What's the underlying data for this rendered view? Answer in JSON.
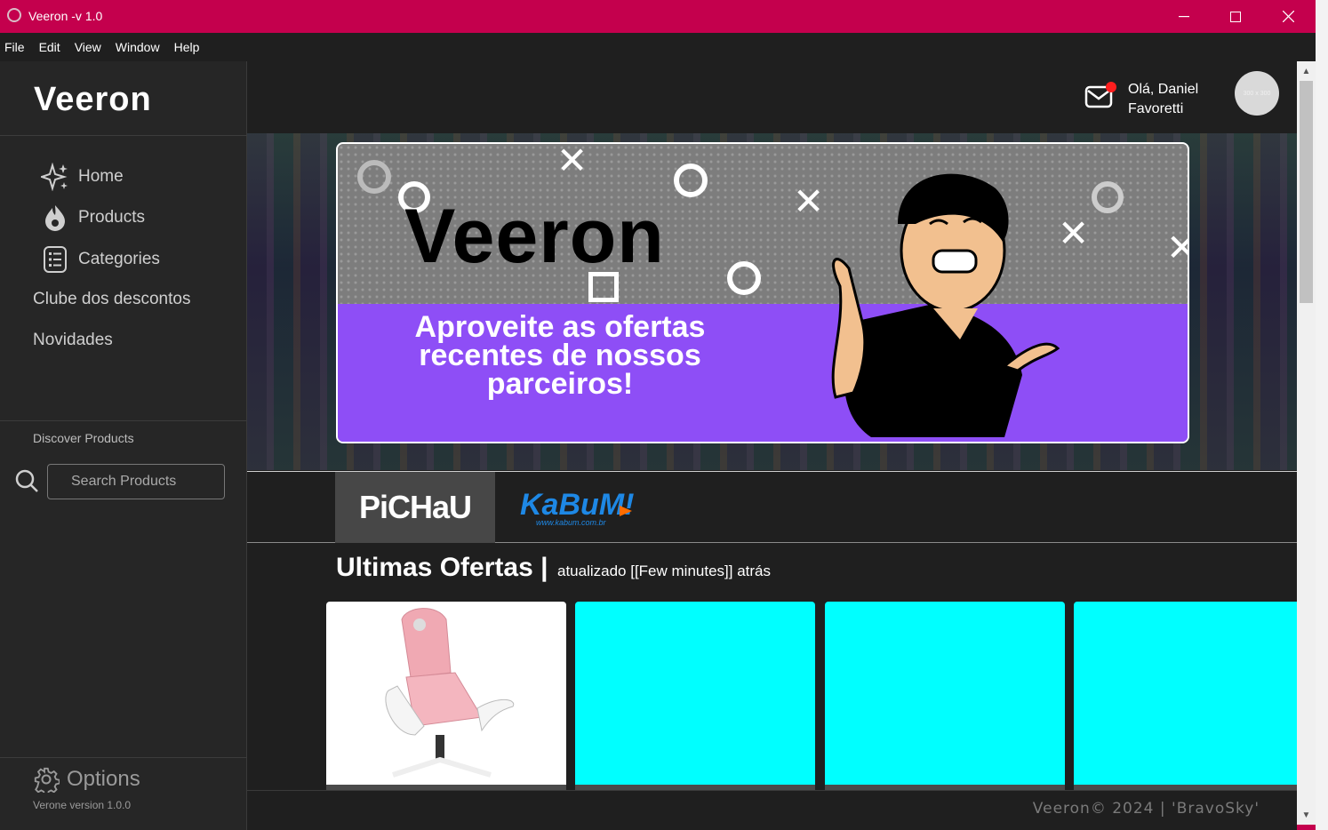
{
  "window": {
    "title": "Veeron -v 1.0",
    "accent": "#c4004d"
  },
  "menu": [
    "File",
    "Edit",
    "View",
    "Window",
    "Help"
  ],
  "sidebar": {
    "brand": "Veeron",
    "items": [
      {
        "label": "Home",
        "icon": "sparkle-icon"
      },
      {
        "label": "Products",
        "icon": "flame-icon"
      },
      {
        "label": "Categories",
        "icon": "list-icon"
      }
    ],
    "links": [
      "Clube dos descontos",
      "Novidades"
    ],
    "discover_label": "Discover Products",
    "search_placeholder": "Search Products",
    "options_label": "Options",
    "version": "Verone version 1.0.0"
  },
  "header": {
    "greeting_line1": "Olá, Daniel",
    "greeting_line2": "Favoretti",
    "avatar_text": "300 x 300"
  },
  "banner": {
    "word": "Veeron",
    "tagline_1": "Aproveite as ofertas",
    "tagline_2": "recentes de nossos",
    "tagline_3": "parceiros!"
  },
  "stores": [
    {
      "label": "PiCHaU"
    },
    {
      "label": "KaBuM!",
      "sub": "www.kabum.com.br"
    }
  ],
  "section": {
    "title": "Ultimas Ofertas |",
    "subtitle": "atualizado [[Few minutes]] atrás"
  },
  "cards": [
    {
      "type": "image",
      "icon": "pink-gaming-chair"
    },
    {
      "type": "placeholder"
    },
    {
      "type": "placeholder"
    },
    {
      "type": "placeholder"
    }
  ],
  "colors": {
    "placeholder": "#00ffff",
    "banner_purple": "#8e4ef6"
  },
  "footer": "Veeron© 2024 | 'BravoSky'"
}
